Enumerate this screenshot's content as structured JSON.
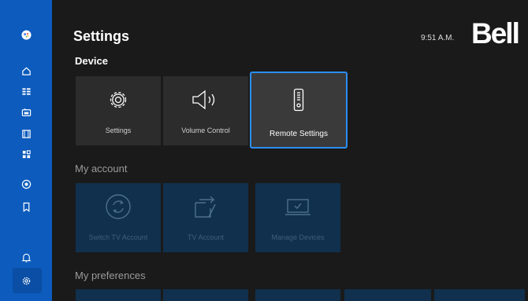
{
  "header": {
    "title": "Settings",
    "time": "9:51 A.M.",
    "brand": "Bell"
  },
  "sidebar": {
    "items": [
      {
        "icon": "google-assistant-icon"
      },
      {
        "icon": "home-icon"
      },
      {
        "icon": "guide-icon"
      },
      {
        "icon": "tv-icon"
      },
      {
        "icon": "movies-icon"
      },
      {
        "icon": "apps-icon"
      },
      {
        "icon": "record-icon"
      },
      {
        "icon": "bookmark-icon"
      },
      {
        "icon": "bell-icon"
      },
      {
        "icon": "gear-icon",
        "selected": true
      }
    ]
  },
  "sections": {
    "device": {
      "title": "Device",
      "tiles": [
        {
          "label": "Settings",
          "icon": "gear-icon"
        },
        {
          "label": "Volume Control",
          "icon": "volume-icon"
        },
        {
          "label": "Remote Settings",
          "icon": "remote-icon",
          "focused": true
        }
      ]
    },
    "account": {
      "title": "My account",
      "tiles": [
        {
          "label": "Switch TV Account",
          "icon": "switch-account-icon"
        },
        {
          "label": "TV Account",
          "icon": "tv-account-icon"
        },
        {
          "label": "Manage Devices",
          "icon": "laptop-icon"
        }
      ]
    },
    "preferences": {
      "title": "My preferences"
    }
  },
  "colors": {
    "accent": "#0c5bbd",
    "focus": "#2b8ff2",
    "background": "#1a1a1a"
  }
}
